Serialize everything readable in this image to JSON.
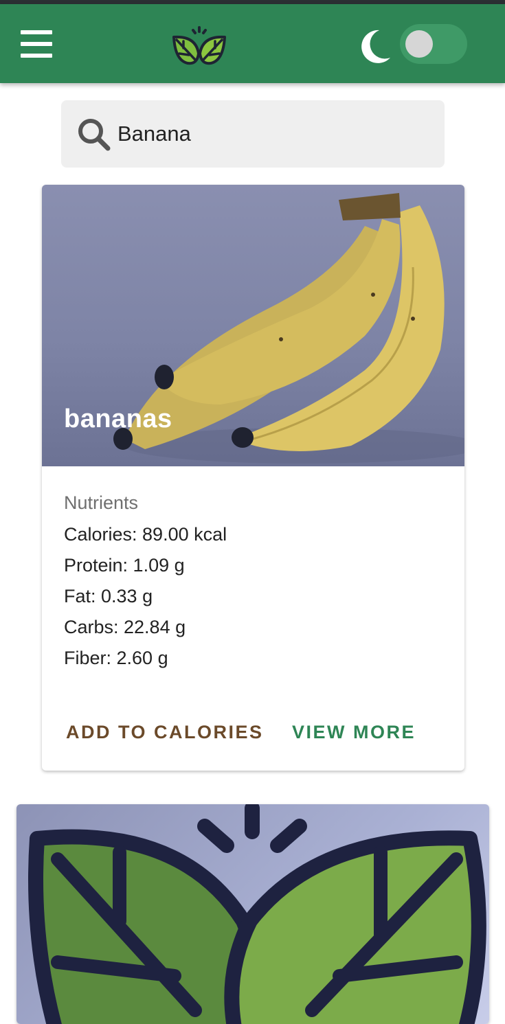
{
  "app": {
    "menu_icon": "hamburger-menu-icon",
    "logo_icon": "leaf-logo-icon",
    "theme_icon": "moon-icon",
    "dark_mode_enabled": false
  },
  "search": {
    "value": "Banana",
    "icon": "search-icon"
  },
  "result": {
    "title": "bananas",
    "nutrients_heading": "Nutrients",
    "nutrients": [
      "Calories: 89.00 kcal",
      "Protein: 1.09 g",
      "Fat: 0.33 g",
      "Carbs: 22.84 g",
      "Fiber: 2.60 g"
    ],
    "add_label": "ADD TO CALORIES",
    "more_label": "VIEW MORE"
  },
  "colors": {
    "appbar": "#2e8555",
    "add_action": "#6b4a2a",
    "more_action": "#2e8555"
  }
}
